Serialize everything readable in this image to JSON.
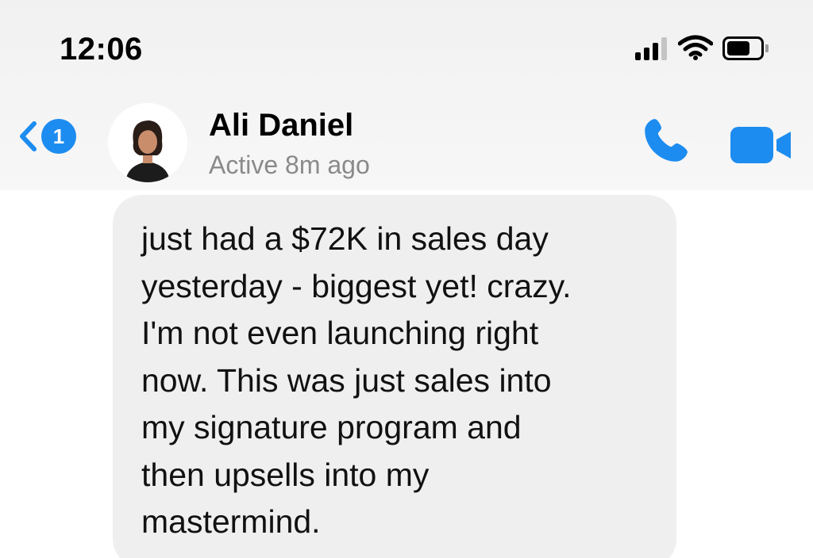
{
  "status_bar": {
    "time": "12:06",
    "icons": [
      "signal-icon",
      "wifi-icon",
      "battery-icon"
    ],
    "signal_bars": 3,
    "signal_bars_total": 4,
    "battery_level": 0.55
  },
  "header": {
    "unread_count": "1",
    "contact_name": "Ali Daniel",
    "contact_status": "Active 8m ago",
    "icons": [
      "back-chevron-icon",
      "phone-icon",
      "video-camera-icon"
    ]
  },
  "message": {
    "text": "just had a $72K in sales day\nyesterday - biggest yet! crazy.\nI'm not even launching right\nnow. This was just sales into\nmy signature program and\nthen upsells into my\nmastermind."
  },
  "colors": {
    "accent": "#1d8cf0",
    "bubble": "#efefef",
    "secondary_text": "#8a8a8a"
  }
}
